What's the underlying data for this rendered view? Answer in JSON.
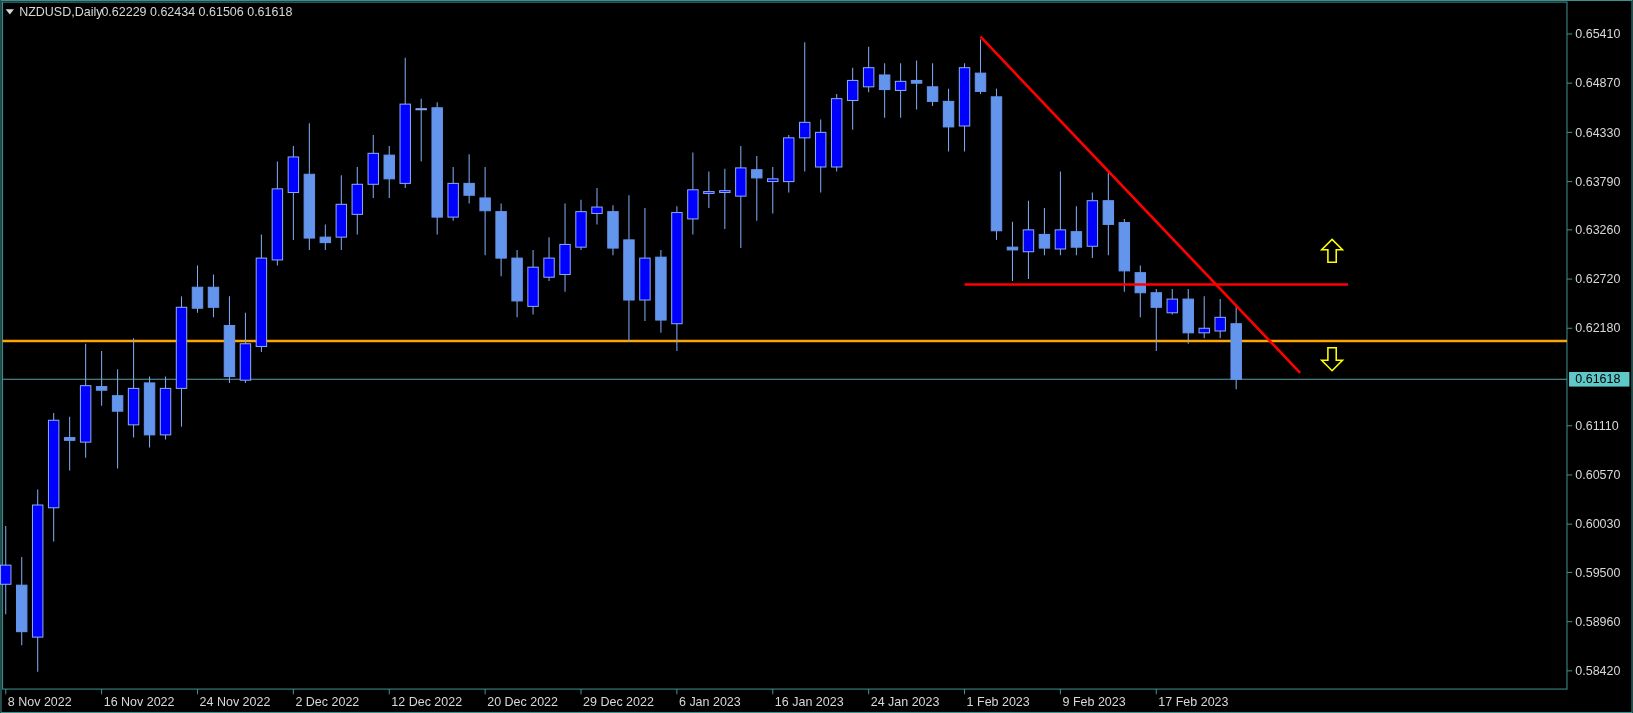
{
  "chart": {
    "symbol": "NZDUSD,Daily",
    "ohlc": "0.62229 0.62434 0.61506 0.61618",
    "price_axis": [
      "0.65410",
      "0.64870",
      "0.64330",
      "0.63790",
      "0.63260",
      "0.62720",
      "0.62180",
      "0.61110",
      "0.60570",
      "0.60030",
      "0.59500",
      "0.58960",
      "0.58420"
    ],
    "current_price": "0.61618",
    "time_axis": [
      "8 Nov 2022",
      "16 Nov 2022",
      "24 Nov 2022",
      "2 Dec 2022",
      "12 Dec 2022",
      "20 Dec 2022",
      "29 Dec 2022",
      "6 Jan 2023",
      "16 Jan 2023",
      "24 Jan 2023",
      "1 Feb 2023",
      "9 Feb 2023",
      "17 Feb 2023"
    ]
  }
}
